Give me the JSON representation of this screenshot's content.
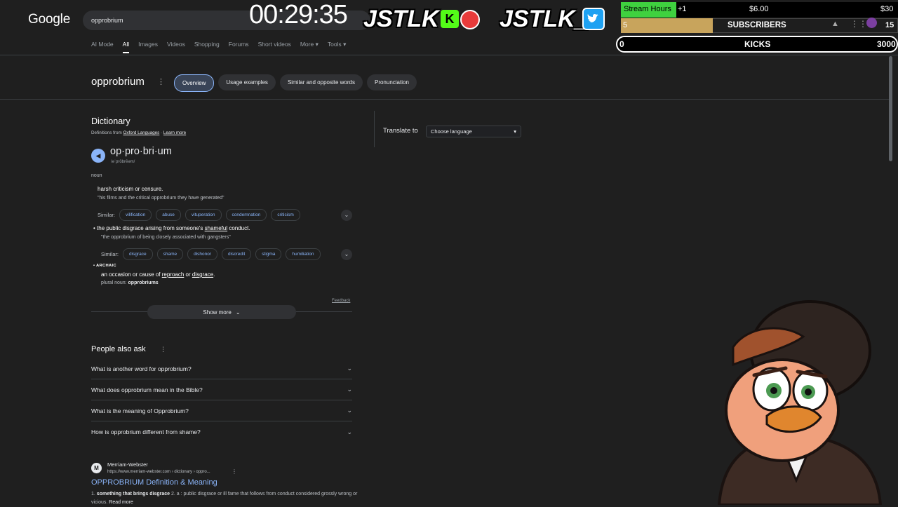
{
  "header": {
    "logo": "Google",
    "search_value": "opprobrium",
    "tabs": [
      "AI Mode",
      "All",
      "Images",
      "Videos",
      "Shopping",
      "Forums",
      "Short videos",
      "More",
      "Tools"
    ]
  },
  "term": {
    "title": "opprobrium",
    "chips": [
      "Overview",
      "Usage examples",
      "Similar and opposite words",
      "Pronunciation"
    ]
  },
  "dictionary": {
    "heading": "Dictionary",
    "source_prefix": "Definitions from ",
    "source_link": "Oxford Languages",
    "source_sep": " · ",
    "learn_more": "Learn more",
    "headword": "op·pro·bri·um",
    "phonetic": "/əˈprōbrēəm/",
    "part_of_speech": "noun",
    "def1": "harsh criticism or censure.",
    "example1": "\"his films and the critical opprobrium they have generated\"",
    "similar_label": "Similar:",
    "similar1": [
      "vilification",
      "abuse",
      "vituperation",
      "condemnation",
      "criticism"
    ],
    "def2_pre": "the public disgrace arising from someone's ",
    "def2_link": "shameful",
    "def2_post": " conduct.",
    "example2": "\"the opprobrium of being closely associated with gangsters\"",
    "similar2": [
      "disgrace",
      "shame",
      "dishonor",
      "discredit",
      "stigma",
      "humiliation"
    ],
    "archaic": "ARCHAIC",
    "def3_pre": "an occasion or cause of ",
    "def3_link1": "reproach",
    "def3_mid": " or ",
    "def3_link2": "disgrace",
    "def3_post": ".",
    "plural_label": "plural noun: ",
    "plural_value": "opprobriums",
    "feedback": "Feedback",
    "show_more": "Show more"
  },
  "translate": {
    "label": "Translate to",
    "select_value": "Choose language"
  },
  "paa": {
    "heading": "People also ask",
    "questions": [
      "What is another word for opprobrium?",
      "What does opprobrium mean in the Bible?",
      "What is the meaning of Opprobrium?",
      "How is opprobrium different from shame?"
    ]
  },
  "result": {
    "site": "Merriam-Webster",
    "url": "https://www.merriam-webster.com › dictionary › oppro...",
    "title": "OPPROBRIUM Definition & Meaning",
    "snippet_bold": "something that brings disgrace",
    "snippet_rest": " 2. a : public disgrace or ill fame that follows from conduct considered grossly wrong or vicious.",
    "read_more": "Read more"
  },
  "overlay": {
    "timer": "00:29:35",
    "brand": "JSTLK",
    "brand2": "JSTLK_",
    "stream_hours_label": "Stream Hours",
    "stream_hours_plus": "+1",
    "stream_hours_amount": "$6.00",
    "stream_hours_goal": "$30",
    "stream_hours_progress": 0.2,
    "subscribers_count": "5",
    "subscribers_label": "SUBSCRIBERS",
    "subscribers_goal": "15",
    "kicks_count": "0",
    "kicks_label": "KICKS",
    "kicks_goal": "3000"
  }
}
